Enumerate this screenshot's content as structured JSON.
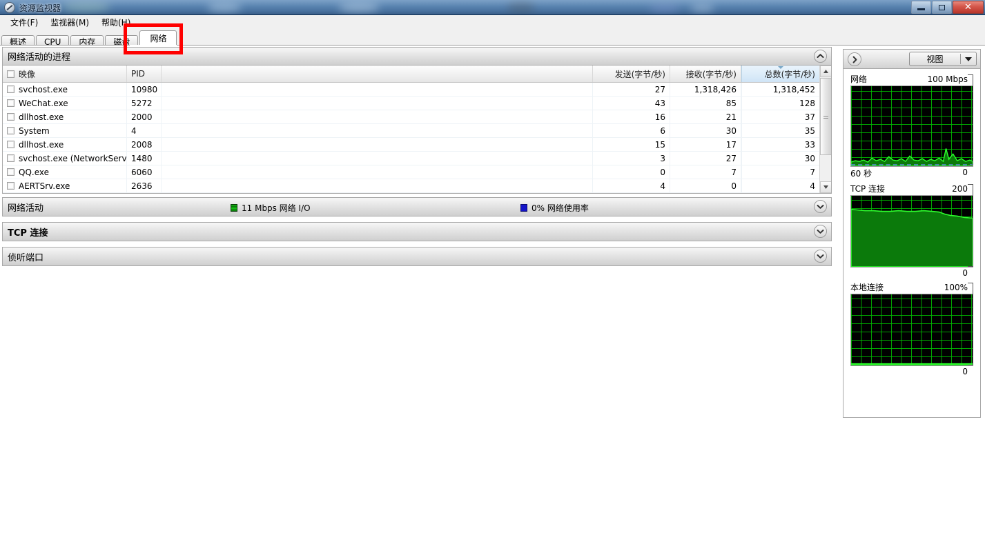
{
  "window": {
    "title": "资源监视器",
    "icon": "resource-monitor-icon",
    "minimize_label": "最小化",
    "maximize_label": "最大化",
    "close_label": "关闭"
  },
  "menubar": {
    "items": [
      {
        "label": "文件(F)"
      },
      {
        "label": "监视器(M)"
      },
      {
        "label": "帮助(H)"
      }
    ]
  },
  "tabs": [
    {
      "label": "概述",
      "active": false
    },
    {
      "label": "CPU",
      "active": false
    },
    {
      "label": "内存",
      "active": false
    },
    {
      "label": "磁盘",
      "active": false
    },
    {
      "label": "网络",
      "active": true
    }
  ],
  "panels": {
    "processes": {
      "title": "网络活动的进程",
      "collapse_icon": "chevron-up-icon",
      "columns": [
        {
          "key": "image",
          "label": "映像",
          "align": "left",
          "sorted": false
        },
        {
          "key": "pid",
          "label": "PID",
          "align": "left",
          "sorted": false
        },
        {
          "key": "spacer",
          "label": "",
          "align": "left",
          "sorted": false
        },
        {
          "key": "sent",
          "label": "发送(字节/秒)",
          "align": "right",
          "sorted": false
        },
        {
          "key": "received",
          "label": "接收(字节/秒)",
          "align": "right",
          "sorted": false
        },
        {
          "key": "total",
          "label": "总数(字节/秒)",
          "align": "right",
          "sorted": true
        }
      ],
      "rows": [
        {
          "image": "svchost.exe",
          "pid": "10980",
          "sent": "27",
          "received": "1,318,426",
          "total": "1,318,452"
        },
        {
          "image": "WeChat.exe",
          "pid": "5272",
          "sent": "43",
          "received": "85",
          "total": "128"
        },
        {
          "image": "dllhost.exe",
          "pid": "2000",
          "sent": "16",
          "received": "21",
          "total": "37"
        },
        {
          "image": "System",
          "pid": "4",
          "sent": "6",
          "received": "30",
          "total": "35"
        },
        {
          "image": "dllhost.exe",
          "pid": "2008",
          "sent": "15",
          "received": "17",
          "total": "33"
        },
        {
          "image": "svchost.exe (NetworkService)",
          "pid": "1480",
          "sent": "3",
          "received": "27",
          "total": "30"
        },
        {
          "image": "QQ.exe",
          "pid": "6060",
          "sent": "0",
          "received": "7",
          "total": "7"
        },
        {
          "image": "AERTSrv.exe",
          "pid": "2636",
          "sent": "4",
          "received": "0",
          "total": "4"
        }
      ]
    },
    "network_activity": {
      "title": "网络活动",
      "collapse_icon": "chevron-down-icon",
      "summary": [
        {
          "swatch": "green",
          "text": "11 Mbps 网络 I/O"
        },
        {
          "swatch": "blue",
          "text": "0% 网络使用率"
        }
      ]
    },
    "tcp_connections": {
      "title": "TCP 连接",
      "collapse_icon": "chevron-down-icon"
    },
    "listening_ports": {
      "title": "侦听端口",
      "collapse_icon": "chevron-down-icon"
    }
  },
  "sidebar": {
    "expand_icon": "chevron-right-icon",
    "view_button": {
      "label": "视图",
      "caret_icon": "caret-down-icon"
    },
    "graphs": [
      {
        "name": "network",
        "title": "网络",
        "scale_max": "100 Mbps",
        "axis_left": "60 秒",
        "axis_right": "0"
      },
      {
        "name": "tcp-connections",
        "title": "TCP 连接",
        "scale_max": "200",
        "axis_left": "",
        "axis_right": "0"
      },
      {
        "name": "local-area-connection",
        "title": "本地连接",
        "scale_max": "100%",
        "axis_left": "",
        "axis_right": "0"
      }
    ]
  },
  "annotation": {
    "target": "网络",
    "color": "#ff0000"
  },
  "colors": {
    "graph_green": "#00c800",
    "graph_fill": "#0a8a0a",
    "graph_bg": "#000000",
    "accent_blue": "#1414c8",
    "annotation_red": "#ff0000"
  }
}
